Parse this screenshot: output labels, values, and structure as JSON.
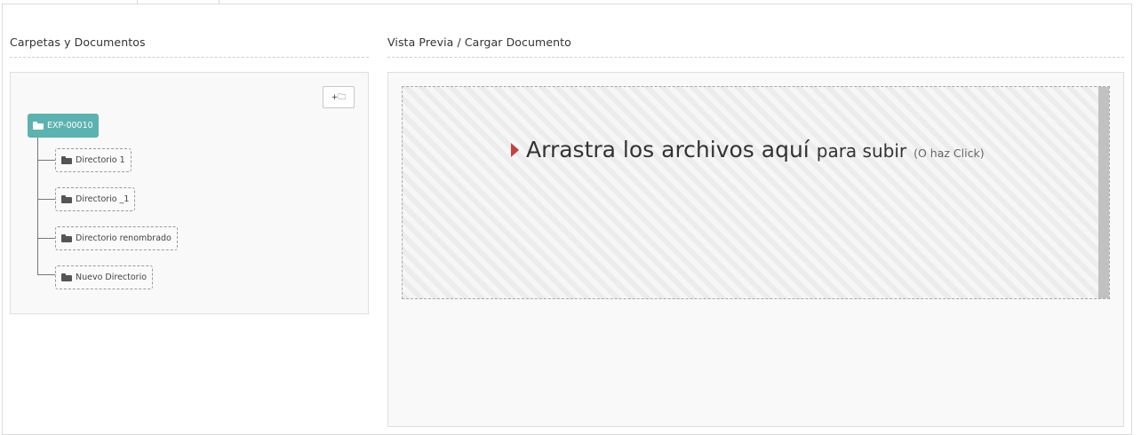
{
  "left_section": {
    "title": "Carpetas y Documentos",
    "tree": {
      "root": {
        "label": "EXP-00010",
        "icon": "folder-open-icon"
      },
      "children": [
        {
          "label": "Directorio 1",
          "icon": "folder-icon"
        },
        {
          "label": "Directorio _1",
          "icon": "folder-icon"
        },
        {
          "label": "Directorio renombrado",
          "icon": "folder-icon"
        },
        {
          "label": "Nuevo Directorio",
          "icon": "folder-icon"
        }
      ]
    },
    "new_folder_button": {
      "label": "+🗀",
      "icon": "new-folder-icon"
    }
  },
  "right_section": {
    "title": "Vista Previa / Cargar Documento",
    "dropzone": {
      "message_main": "Arrastra los archivos aquí",
      "message_mid": "para subir",
      "message_hint": "(O haz Click)"
    }
  },
  "colors": {
    "accent": "#5cb2b1",
    "caret": "#c24141",
    "panel_bg": "#f9f9f9"
  }
}
